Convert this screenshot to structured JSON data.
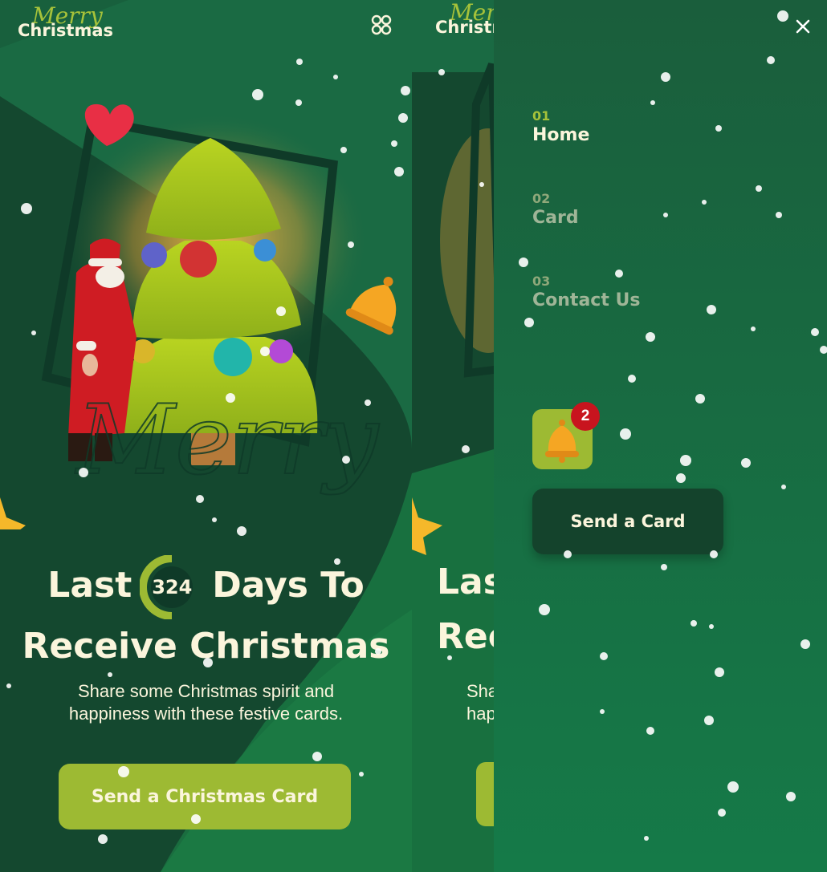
{
  "logo": {
    "merry": "Merry",
    "christmas": "Christmas"
  },
  "hero": {
    "line1_pre": "Last",
    "days_count": "324",
    "line1_post": "Days To",
    "line2": "Receive Christmas",
    "subtitle_line1": "Share some Christmas spirit and",
    "subtitle_line2": "happiness with these festive cards.",
    "cta_label": "Send a Christmas Card",
    "script_word": "Merry"
  },
  "menu": {
    "items": [
      {
        "number": "01",
        "label": "Home",
        "active": true
      },
      {
        "number": "02",
        "label": "Card",
        "active": false
      },
      {
        "number": "03",
        "label": "Contact Us",
        "active": false
      }
    ],
    "notification_count": "2",
    "send_label": "Send a Card"
  },
  "colors": {
    "bg_green": "#18603d",
    "dark_green": "#0f3a28",
    "accent_lime": "#9dba33",
    "cream": "#fbf5dc",
    "badge_red": "#c8141e"
  },
  "icons": [
    "grid-menu-icon",
    "close-icon",
    "bell-icon",
    "heart-icon",
    "star-icon"
  ]
}
